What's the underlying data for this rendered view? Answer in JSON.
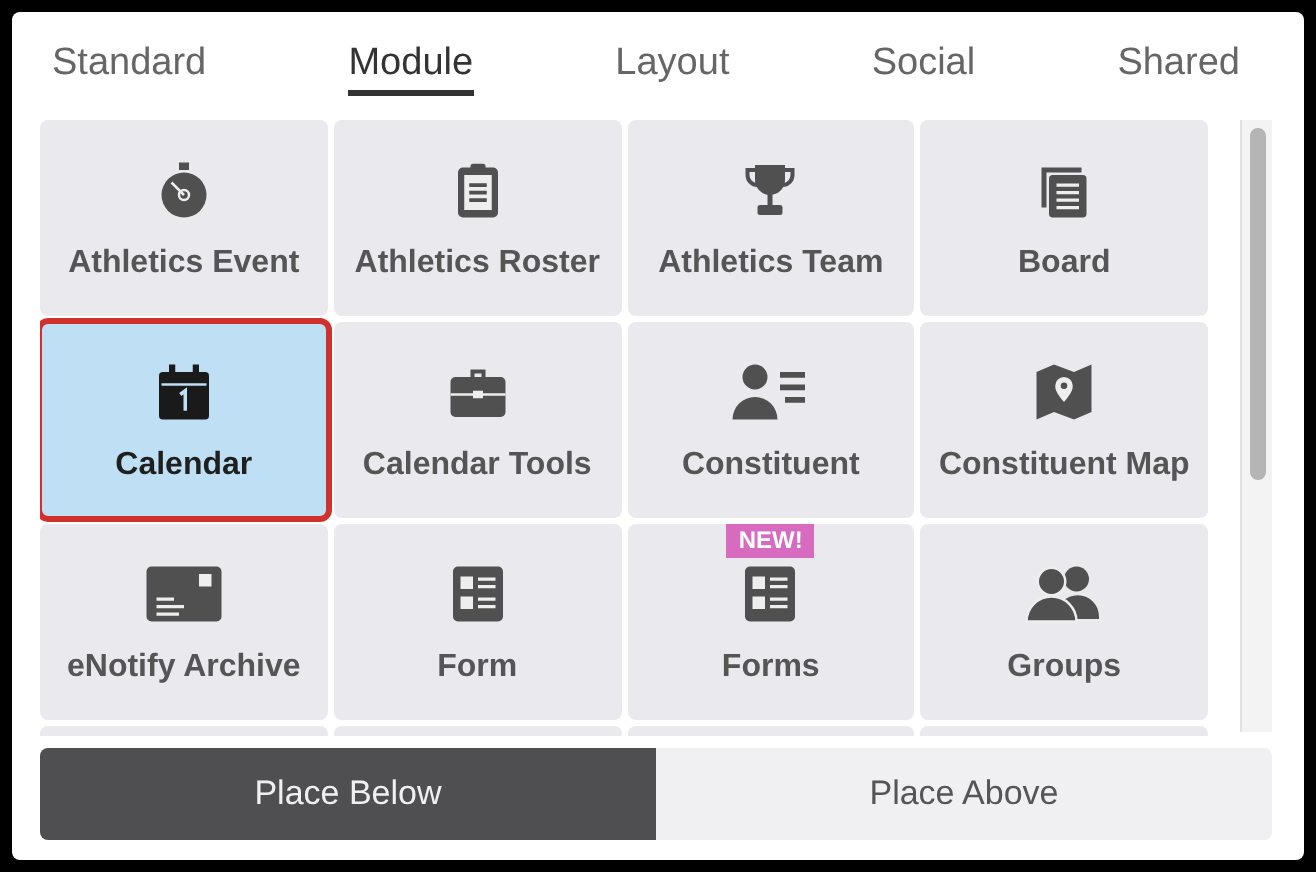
{
  "tabs": [
    {
      "label": "Standard",
      "selected": false
    },
    {
      "label": "Module",
      "selected": true
    },
    {
      "label": "Layout",
      "selected": false
    },
    {
      "label": "Social",
      "selected": false
    },
    {
      "label": "Shared",
      "selected": false
    }
  ],
  "modules": [
    {
      "label": "Athletics Event",
      "selected": false
    },
    {
      "label": "Athletics Roster",
      "selected": false
    },
    {
      "label": "Athletics Team",
      "selected": false
    },
    {
      "label": "Board",
      "selected": false
    },
    {
      "label": "Calendar",
      "selected": true
    },
    {
      "label": "Calendar Tools",
      "selected": false
    },
    {
      "label": "Constituent",
      "selected": false
    },
    {
      "label": "Constituent Map",
      "selected": false
    },
    {
      "label": "eNotify Archive",
      "selected": false
    },
    {
      "label": "Form",
      "selected": false
    },
    {
      "label": "Forms",
      "selected": false,
      "badge": "NEW!"
    },
    {
      "label": "Groups",
      "selected": false
    }
  ],
  "placement": [
    {
      "label": "Place Below",
      "selected": true
    },
    {
      "label": "Place Above",
      "selected": false
    }
  ]
}
